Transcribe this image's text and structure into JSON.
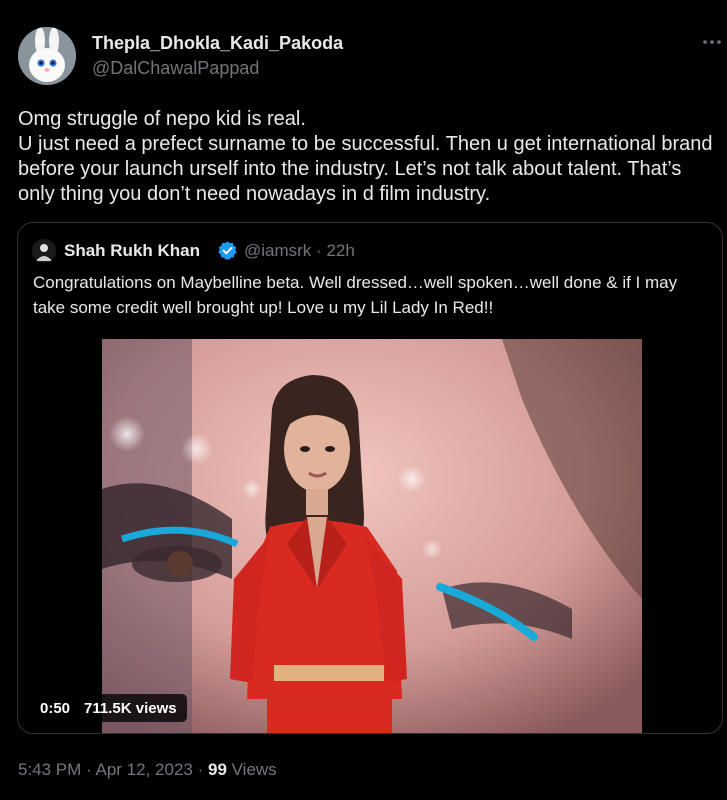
{
  "tweet": {
    "display_name": "Thepla_Dhokla_Kadi_Pakoda",
    "handle": "@DalChawalPappad",
    "text": "Omg struggle of nepo kid is real.\nU just need a prefect surname to be successful. Then u get international brand before your launch urself into the industry. Let’s not talk about talent. That’s only thing you don’t need nowadays in d film industry.",
    "time": "5:43 PM",
    "date": "Apr 12, 2023",
    "views_count": "99",
    "views_label": "Views"
  },
  "quote": {
    "display_name": "Shah Rukh Khan",
    "handle": "@iamsrk",
    "age": "22h",
    "text": "Congratulations on Maybelline beta. Well dressed…well spoken…well done & if I may take some credit well brought up! Love u my Lil Lady In Red!!",
    "video_duration": "0:50",
    "video_views": "711.5K views"
  },
  "colors": {
    "background": "#000000",
    "text_primary": "#e7e9ea",
    "text_secondary": "#71767b",
    "verified": "#1d9bf0",
    "border": "#2f3336"
  },
  "icons": {
    "more": "more-horizontal-icon",
    "verified": "verified-badge-icon",
    "avatar": "bunny-avatar",
    "quote_avatar": "srk-avatar"
  }
}
